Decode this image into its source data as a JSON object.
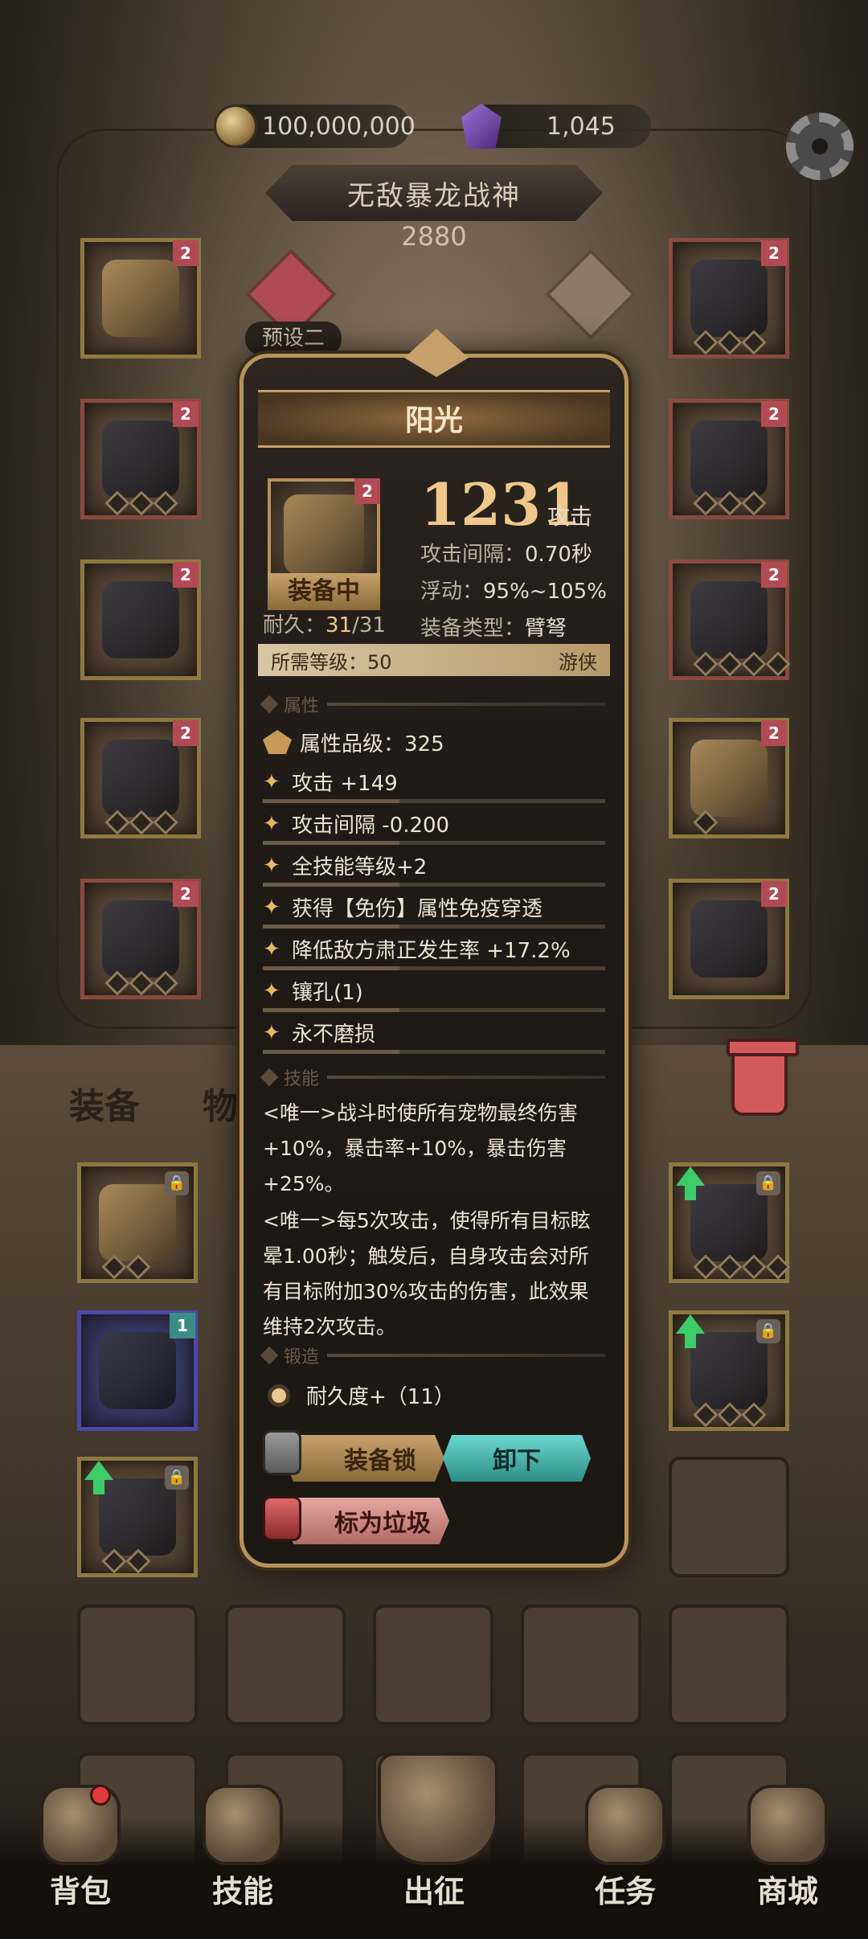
{
  "currency": {
    "gold_icon": "gold-coin-icon",
    "gold": "100,000,000",
    "gem_icon": "purple-gem-icon",
    "gems": "1,045"
  },
  "hero": {
    "title": "无敌暴龙战神",
    "score": "2880",
    "preset_label": "预设二"
  },
  "slot_badge": "2",
  "locked_badge": "1",
  "tabs": {
    "equipment": "装备",
    "items": "物品"
  },
  "item": {
    "name": "阳光",
    "badge": "2",
    "equipped_tag": "装备中",
    "attack_value": "1231",
    "attack_unit": "攻击",
    "attack_interval_label": "攻击间隔：",
    "attack_interval_value": "0.70秒",
    "float_label": "浮动：",
    "float_value": "95%~105%",
    "type_label": "装备类型：",
    "type_value": "臂弩",
    "durability_label": "耐久：",
    "durability_value": "31",
    "durability_max": "/31",
    "required_level": "所需等级：50",
    "class": "游侠",
    "section_attributes": "属性",
    "quality": "属性品级：325",
    "attributes": [
      "攻击 +149",
      "攻击间隔 -0.200",
      "全技能等级+2",
      "获得【免伤】属性免疫穿透",
      "降低敌方肃正发生率 +17.2%",
      "镶孔(1)",
      "永不磨损"
    ],
    "section_skills": "技能",
    "skill_1": "<唯一>战斗时使所有宠物最终伤害+10%，暴击率+10%，暴击伤害+25%。",
    "skill_2": "<唯一>每5次攻击，使得所有目标眩晕1.00秒；触发后，自身攻击会对所有目标附加30%攻击的伤害，此效果维持2次攻击。",
    "section_forge": "锻造",
    "forge": "耐久度+（11）",
    "buttons": {
      "lock": "装备锁",
      "unequip": "卸下",
      "junk": "标为垃圾"
    }
  },
  "nav": [
    {
      "label": "背包",
      "icon": "backpack-icon"
    },
    {
      "label": "技能",
      "icon": "skill-book-icon"
    },
    {
      "label": "出征",
      "icon": "sword-map-icon"
    },
    {
      "label": "任务",
      "icon": "scroll-icon"
    },
    {
      "label": "商城",
      "icon": "shop-crown-icon"
    }
  ],
  "colors": {
    "accent_gold": "#b9925a",
    "badge_red": "#b24a54",
    "unequip_teal": "#2f8e88",
    "upgrade_green": "#3ecb6a"
  }
}
